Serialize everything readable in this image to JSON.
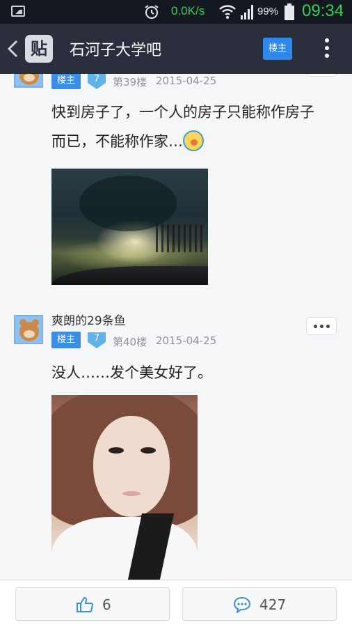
{
  "status_bar": {
    "net_speed": "0.0K/s",
    "battery_percent": "99%",
    "time": "09:34"
  },
  "header": {
    "logo_text": "贴",
    "title": "石河子大学吧",
    "owner_button": "楼主"
  },
  "posts": [
    {
      "badge": "楼主",
      "level": "7",
      "floor": "第39楼",
      "date": "2015-04-25",
      "text_line1": "快到房子了，一个人的房子只能称作房子",
      "text_line2": "而已，不能称作家…"
    },
    {
      "username": "爽朗的29条鱼",
      "badge": "楼主",
      "level": "7",
      "floor": "第40楼",
      "date": "2015-04-25",
      "text_line1": "没人……发个美女好了。"
    }
  ],
  "footer": {
    "like_count": "6",
    "comment_count": "427"
  },
  "colors": {
    "titlebar_bg": "#2b2f3d",
    "accent_blue": "#3b8ee6",
    "status_green": "#2fd15a"
  }
}
